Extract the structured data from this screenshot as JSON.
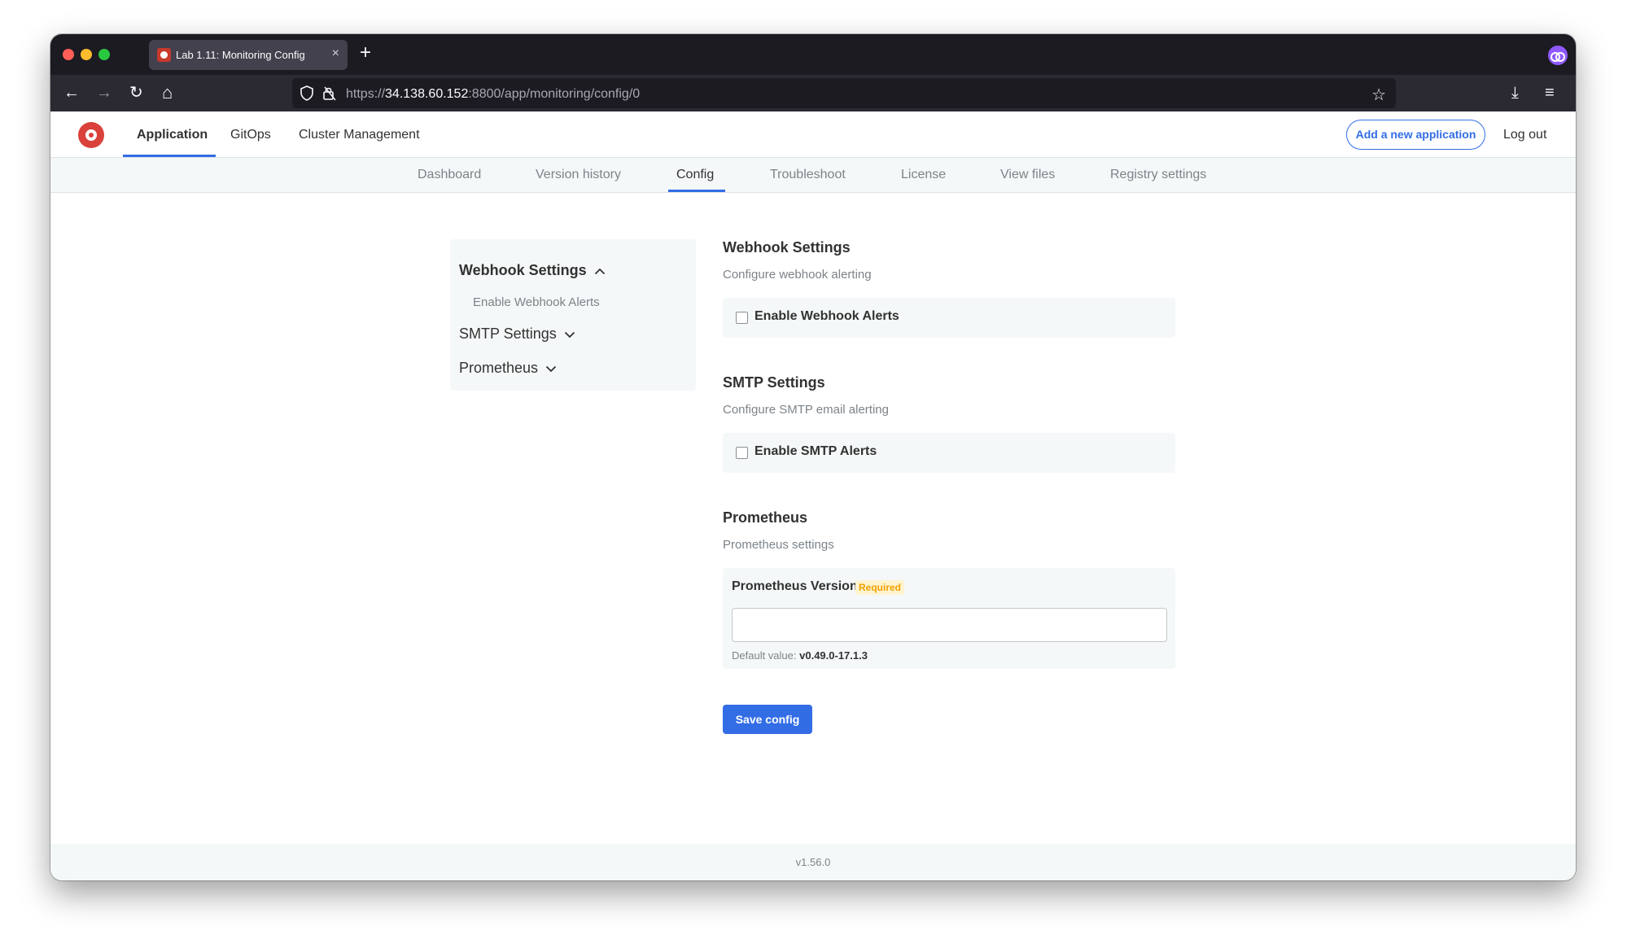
{
  "browser": {
    "tab_title": "Lab 1.11: Monitoring Config",
    "tab_close": "×",
    "new_tab": "+",
    "url_scheme": "https://",
    "url_host": "34.138.60.152",
    "url_rest": ":8800/app/monitoring/config/0",
    "icons": {
      "back": "←",
      "forward": "→",
      "reload": "↻",
      "home": "⌂",
      "bookmark": "☆",
      "download": "⤓",
      "menu": "≡"
    }
  },
  "header": {
    "nav": [
      "Application",
      "GitOps",
      "Cluster Management"
    ],
    "active_nav": "Application",
    "add_app_label": "Add a new application",
    "logout_label": "Log out"
  },
  "subnav": {
    "tabs": [
      "Dashboard",
      "Version history",
      "Config",
      "Troubleshoot",
      "License",
      "View files",
      "Registry settings"
    ],
    "active": "Config"
  },
  "config_nav": {
    "groups": [
      {
        "label": "Webhook Settings",
        "expanded": true,
        "items": [
          "Enable Webhook Alerts"
        ]
      },
      {
        "label": "SMTP Settings",
        "expanded": false
      },
      {
        "label": "Prometheus",
        "expanded": false
      }
    ]
  },
  "sections": {
    "webhook": {
      "title": "Webhook Settings",
      "description": "Configure webhook alerting",
      "checkbox_label": "Enable Webhook Alerts",
      "checked": false
    },
    "smtp": {
      "title": "SMTP Settings",
      "description": "Configure SMTP email alerting",
      "checkbox_label": "Enable SMTP Alerts",
      "checked": false
    },
    "prometheus": {
      "title": "Prometheus",
      "description": "Prometheus settings",
      "field_label": "Prometheus Version",
      "required_badge": "Required",
      "value": "",
      "default_prefix": "Default value:",
      "default_value": "v0.49.0-17.1.3"
    }
  },
  "save_label": "Save config",
  "footer": {
    "version": "v1.56.0"
  },
  "colors": {
    "accent": "#326de6",
    "required": "#f0a000",
    "panel": "#f5f8f9"
  }
}
